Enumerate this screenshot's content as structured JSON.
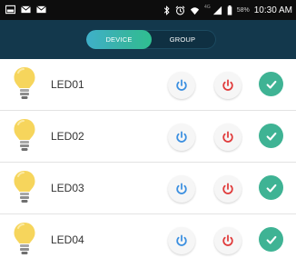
{
  "status_bar": {
    "icons_left": [
      "image-icon",
      "mail-icon",
      "mail-icon"
    ],
    "icons_right": [
      "bluetooth-icon",
      "alarm-icon",
      "signal-icon",
      "battery-icon"
    ],
    "network": "4G",
    "battery": "58%",
    "time": "10:30 AM"
  },
  "tabs": {
    "device_label": "DEVICE",
    "group_label": "GROUP",
    "selected": "DEVICE"
  },
  "devices": [
    {
      "name": "LED01",
      "checked": true
    },
    {
      "name": "LED02",
      "checked": true
    },
    {
      "name": "LED03",
      "checked": true
    },
    {
      "name": "LED04",
      "checked": true
    }
  ],
  "colors": {
    "header": "#13384c",
    "tab_active": "#38b4a3",
    "power_on": "#3b8fe0",
    "power_off": "#e03a3a",
    "check": "#3fb394",
    "bulb": "#f6d55c"
  }
}
